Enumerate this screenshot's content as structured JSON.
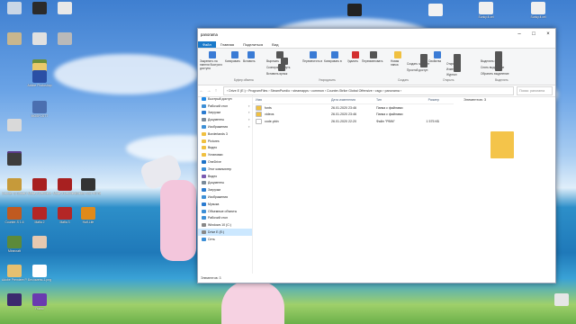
{
  "desktop": {
    "icons": [
      {
        "label": "",
        "color": "#c9d6e6"
      },
      {
        "label": "",
        "color": "#2b2b2b"
      },
      {
        "label": "",
        "color": "#e8e8e8"
      },
      {
        "label": "",
        "color": "#c8b68e"
      },
      {
        "label": "",
        "color": "#e0e0e0"
      },
      {
        "label": "",
        "color": "#b9b9b9"
      },
      {
        "label": "",
        "color": "#6b8f3a"
      },
      {
        "label": "",
        "color": "#e9c96a"
      },
      {
        "label": "Adobe Photoshop",
        "color": "#2a4fa5"
      },
      {
        "label": "MOSFCSTT",
        "color": "#4b6fb0"
      },
      {
        "label": "",
        "color": "#d9d9d9"
      },
      {
        "label": "",
        "color": "#222222"
      },
      {
        "label": "",
        "color": "#5a3a8a"
      },
      {
        "label": "",
        "color": "#3d3d3d"
      },
      {
        "label": "Counter-S Global O...",
        "color": "#c69a3a"
      },
      {
        "label": "Mafia 2 Definitive",
        "color": "#a82020"
      },
      {
        "label": "Mafia 3 Definitive",
        "color": "#a82020"
      },
      {
        "label": "Golden Slot HD Ree...",
        "color": "#333333"
      },
      {
        "label": "Counter-S 1.6",
        "color": "#c05a20"
      },
      {
        "label": "Mafia 2",
        "color": "#b42626"
      },
      {
        "label": "Mafia 3",
        "color": "#b42626"
      },
      {
        "label": "Half-Life",
        "color": "#e08a1a"
      },
      {
        "label": "Minecraft",
        "color": "#5c8a3a"
      },
      {
        "label": "",
        "color": "#e6c9b0"
      },
      {
        "label": "Adobe Premiere P...",
        "color": "#e6c070"
      },
      {
        "label": "Без имени-1.png",
        "color": "#ffffff"
      },
      {
        "label": "",
        "color": "#3c2a6e"
      },
      {
        "label": "Ролик",
        "color": "#6a3ab0"
      },
      {
        "label": "",
        "color": "#222222"
      },
      {
        "label": "",
        "color": "#f2f2f2"
      },
      {
        "label": "Sunky.fl.cel",
        "color": "#f0f0f0"
      },
      {
        "label": "Sunky.fl.cel",
        "color": "#f0f0f0"
      },
      {
        "label": "",
        "color": "#efefef"
      },
      {
        "label": "",
        "color": "#444444"
      },
      {
        "label": "",
        "color": "#e6e6e6"
      }
    ]
  },
  "window": {
    "title": "panorama",
    "tabs": [
      "Файл",
      "Главная",
      "Поделиться",
      "Вид"
    ],
    "ribbon": {
      "items": [
        {
          "label": "Закрепить на панели быстрого доступа",
          "color": "#3a7bd5"
        },
        {
          "label": "Копировать",
          "color": "#3a7bd5"
        },
        {
          "label": "Вставить",
          "color": "#3a7bd5"
        },
        {
          "label": "Вырезать",
          "color": "#555555"
        },
        {
          "label": "Скопировать путь",
          "color": "#555555"
        },
        {
          "label": "Вставить ярлык",
          "color": "#555555"
        },
        {
          "label": "Переместить в",
          "color": "#3a7bd5"
        },
        {
          "label": "Копировать в",
          "color": "#3a7bd5"
        },
        {
          "label": "Удалить",
          "color": "#d32f2f"
        },
        {
          "label": "Переименовать",
          "color": "#555555"
        },
        {
          "label": "Новая папка",
          "color": "#f0c040"
        },
        {
          "label": "Создать элемент",
          "color": "#555555"
        },
        {
          "label": "Простой доступ",
          "color": "#555555"
        },
        {
          "label": "Свойства",
          "color": "#3a7bd5"
        },
        {
          "label": "Открыть",
          "color": "#555555"
        },
        {
          "label": "Изменить",
          "color": "#555555"
        },
        {
          "label": "Журнал",
          "color": "#555555"
        },
        {
          "label": "Выделить все",
          "color": "#555555"
        },
        {
          "label": "Снять выделение",
          "color": "#555555"
        },
        {
          "label": "Обратить выделение",
          "color": "#555555"
        }
      ],
      "groups": [
        "Буфер обмена",
        "Упорядочить",
        "Создать",
        "Открыть",
        "Выделить"
      ]
    },
    "address": {
      "path": "›  Drive E (E:)  ›  ProgramFiles  ›  SteamPuedio  ›  steamapps  ›  common  ›  Counter-Strike Global Offensive  ›  csgo  ›  panorama  ›",
      "search_placeholder": "Поиск: panorama"
    },
    "nav": [
      {
        "label": "Быстрый доступ",
        "color": "#1e88e5",
        "pin": false,
        "sel": false
      },
      {
        "label": "Рабочий стол",
        "color": "#3d8fd6",
        "pin": true,
        "sel": false
      },
      {
        "label": "Загрузки",
        "color": "#2b7bd0",
        "pin": true,
        "sel": false
      },
      {
        "label": "Документы",
        "color": "#7a8a9a",
        "pin": true,
        "sel": false
      },
      {
        "label": "Изображения",
        "color": "#3d8fd6",
        "pin": true,
        "sel": false
      },
      {
        "label": "Borderlands 3",
        "color": "#f0c040",
        "pin": false,
        "sel": false
      },
      {
        "label": "Pictures",
        "color": "#f0c040",
        "pin": false,
        "sel": false
      },
      {
        "label": "Видео",
        "color": "#f0c040",
        "pin": false,
        "sel": false
      },
      {
        "label": "Установки",
        "color": "#f0c040",
        "pin": false,
        "sel": false
      },
      {
        "label": "OneDrive",
        "color": "#1e73c8",
        "pin": false,
        "sel": false
      },
      {
        "label": "Этот компьютер",
        "color": "#3d8fd6",
        "pin": false,
        "sel": false
      },
      {
        "label": "Видео",
        "color": "#7a5ab0",
        "pin": false,
        "sel": false
      },
      {
        "label": "Документы",
        "color": "#7a8a9a",
        "pin": false,
        "sel": false
      },
      {
        "label": "Загрузки",
        "color": "#2b7bd0",
        "pin": false,
        "sel": false
      },
      {
        "label": "Изображения",
        "color": "#3d8fd6",
        "pin": false,
        "sel": false
      },
      {
        "label": "Музыка",
        "color": "#2b7bd0",
        "pin": false,
        "sel": false
      },
      {
        "label": "Объемные объекты",
        "color": "#3d8fd6",
        "pin": false,
        "sel": false
      },
      {
        "label": "Рабочий стол",
        "color": "#3d8fd6",
        "pin": false,
        "sel": false
      },
      {
        "label": "Windows 10 (C:)",
        "color": "#888888",
        "pin": false,
        "sel": false
      },
      {
        "label": "Drive E (E:)",
        "color": "#888888",
        "pin": false,
        "sel": true
      },
      {
        "label": "Сеть",
        "color": "#3d8fd6",
        "pin": false,
        "sel": false
      }
    ],
    "headers": [
      "Имя",
      "Дата изменения",
      "Тип",
      "Размер"
    ],
    "files": [
      {
        "name": "fonts",
        "date": "26.01.2020 23:46",
        "type": "Папка с файлами",
        "size": "",
        "color": "#f0c040"
      },
      {
        "name": "videos",
        "date": "26.01.2020 23:46",
        "type": "Папка с файлами",
        "size": "",
        "color": "#f0c040"
      },
      {
        "name": "code.pbin",
        "date": "26.01.2020 22:20",
        "type": "Файл \"PBIN\"",
        "size": "1 575 КБ",
        "color": "#ffffff"
      }
    ],
    "preview_text": "Элементов: 3",
    "status": "Элементов: 3"
  }
}
